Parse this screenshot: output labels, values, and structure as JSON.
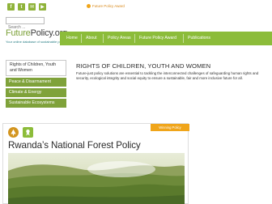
{
  "topbar": {
    "social": [
      {
        "name": "facebook-icon",
        "glyph": "f"
      },
      {
        "name": "twitter-icon",
        "glyph": "t"
      },
      {
        "name": "mail-icon",
        "glyph": "✉"
      },
      {
        "name": "youtube-icon",
        "glyph": "▶"
      }
    ],
    "award_logo_text": "Future Policy Award"
  },
  "search": {
    "placeholder": "Search ..."
  },
  "logo": {
    "name_part1": "Future",
    "name_part2": "Policy.org",
    "tagline": "Your online database of sustainable policy solutions"
  },
  "nav": {
    "items": [
      "Home",
      "About",
      "Policy Areas",
      "Future Policy Award",
      "Publications"
    ]
  },
  "sidebar": {
    "items": [
      {
        "label": "Rights of Children, Youth and Women",
        "active": true
      },
      {
        "label": "Peace & Disarmament",
        "active": false
      },
      {
        "label": "Climate & Energy",
        "active": false
      },
      {
        "label": "Sustainable Ecosystems",
        "active": false
      }
    ]
  },
  "main": {
    "headline": "RIGHTS OF CHILDREN, YOUTH AND WOMEN",
    "description": "Future-just policy solutions are essential to tackling the interconnected challenges of safeguarding human rights and security, ecological integrity and social equity to ensure a sustainable, fair and more inclusive future for all."
  },
  "card": {
    "badge": "Winning Policy",
    "title": "Rwanda’s National Forest Policy"
  },
  "colors": {
    "brand_green": "#8cbc3a",
    "dark_green": "#7fa23a",
    "award_orange": "#f0a51a"
  }
}
